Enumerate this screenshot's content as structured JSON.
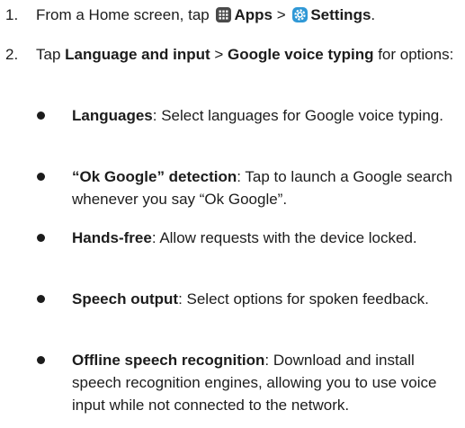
{
  "steps": [
    {
      "number": "1.",
      "text_before": "From a Home screen, tap ",
      "apps_label": "Apps",
      "separator": " > ",
      "settings_label": "Settings",
      "text_after": "."
    },
    {
      "number": "2.",
      "text_before": "Tap ",
      "menu_1": "Language and input",
      "separator": " > ",
      "menu_2": "Google voice typing",
      "text_after": " for options:"
    }
  ],
  "options": [
    {
      "term": "Languages",
      "description": ": Select languages for Google voice typing."
    },
    {
      "term": "“Ok Google” detection",
      "description": ": Tap to launch a Google search whenever you say “Ok Google”."
    },
    {
      "term": "Hands-free",
      "description": ": Allow requests with the device locked."
    },
    {
      "term": "Speech output",
      "description": ": Select options for spoken feedback."
    },
    {
      "term": "Offline speech recognition",
      "description": ": Download and install speech recognition engines, allowing you to use voice input while not connected to the network."
    }
  ],
  "icons": {
    "apps": "apps-grid-icon",
    "settings": "settings-gear-icon"
  },
  "colors": {
    "text": "#1c1c1c",
    "apps_icon_bg": "#4a4a4a",
    "settings_icon_bg": "#2f98d6"
  }
}
